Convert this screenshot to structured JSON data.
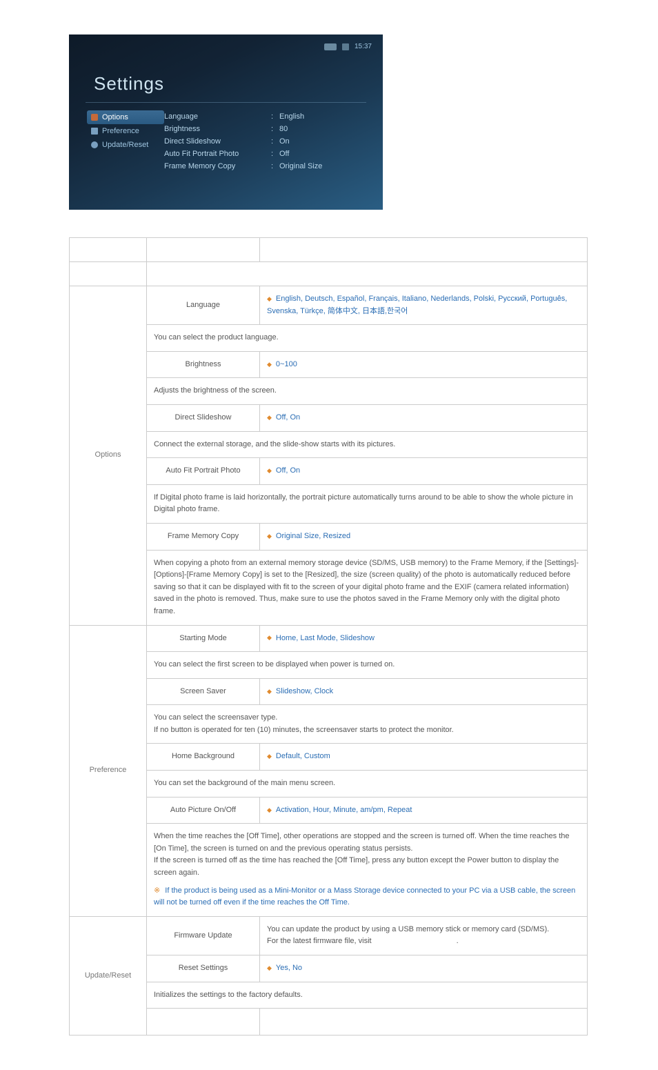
{
  "device": {
    "topbar": {
      "time": "15:37"
    },
    "title": "Settings",
    "sidebar": [
      {
        "label": "Options",
        "active": true,
        "icon": "gear-icon"
      },
      {
        "label": "Preference",
        "active": false,
        "icon": "calendar-icon"
      },
      {
        "label": "Update/Reset",
        "active": false,
        "icon": "refresh-icon"
      }
    ],
    "options": [
      {
        "label": "Language",
        "value": "English"
      },
      {
        "label": "Brightness",
        "value": "80"
      },
      {
        "label": "Direct Slideshow",
        "value": "On"
      },
      {
        "label": "Auto Fit Portrait Photo",
        "value": "Off"
      },
      {
        "label": "Frame Memory Copy",
        "value": "Original Size"
      }
    ]
  },
  "table": {
    "options": {
      "section": "Options",
      "rows": {
        "language": {
          "label": "Language",
          "value": "English, Deutsch, Español, Français, Italiano, Nederlands, Polski, Русский, Português, Svenska, Türkçe, 简体中文, 日本語,한국어",
          "desc": "You can select the product language."
        },
        "brightness": {
          "label": "Brightness",
          "value": "0~100",
          "desc": "Adjusts the brightness of the screen."
        },
        "direct_slideshow": {
          "label": "Direct Slideshow",
          "value": "Off, On",
          "desc": "Connect the external storage, and the slide-show starts with its pictures."
        },
        "auto_fit": {
          "label": "Auto Fit Portrait Photo",
          "value": "Off, On",
          "desc": "If Digital photo frame is laid horizontally, the portrait picture automatically turns around to be able to show the whole picture in Digital photo frame."
        },
        "frame_memory": {
          "label": "Frame Memory Copy",
          "value": "Original Size, Resized",
          "desc": "When copying a photo from an external memory storage device (SD/MS, USB memory) to the Frame Memory, if the [Settings]-[Options]-[Frame Memory Copy] is set to the [Resized], the size (screen quality) of the photo is automatically reduced before saving so that it can be displayed with fit to the screen of your digital photo frame and the EXIF (camera related information) saved in the photo is removed. Thus, make sure to use the photos saved in the Frame Memory only with the digital photo frame."
        }
      }
    },
    "preference": {
      "section": "Preference",
      "rows": {
        "starting_mode": {
          "label": "Starting Mode",
          "value": "Home, Last Mode, Slideshow",
          "desc": "You can select the first screen to be displayed when power is turned on."
        },
        "screen_saver": {
          "label": "Screen Saver",
          "value": "Slideshow, Clock",
          "desc1": "You can select the screensaver type.",
          "desc2": "If no button is operated for ten (10) minutes, the screensaver starts to protect the monitor."
        },
        "home_bg": {
          "label": "Home Background",
          "value": "Default, Custom",
          "desc": "You can set the background of the main menu screen."
        },
        "auto_picture": {
          "label": "Auto Picture On/Off",
          "value": "Activation, Hour, Minute, am/pm, Repeat",
          "desc1": "When the time reaches the [Off Time], other operations are stopped and the screen is turned off. When the time reaches the [On Time], the screen is turned on and the previous operating status persists.",
          "desc2": "If the screen is turned off as the time has reached the [Off Time], press any button except the Power button to display the screen again.",
          "note": "If the product is being used as a Mini-Monitor or a Mass Storage device connected to your PC via a USB cable, the screen will not be turned off even if the time reaches the Off Time."
        }
      }
    },
    "update_reset": {
      "section": "Update/Reset",
      "rows": {
        "firmware": {
          "label": "Firmware Update",
          "desc1": "You can update the product by using a USB memory stick or memory card (SD/MS).",
          "desc2": "For the latest firmware file, visit",
          "desc2_after": "."
        },
        "reset": {
          "label": "Reset Settings",
          "value": "Yes, No",
          "desc": "Initializes the settings to the factory defaults."
        }
      }
    }
  }
}
